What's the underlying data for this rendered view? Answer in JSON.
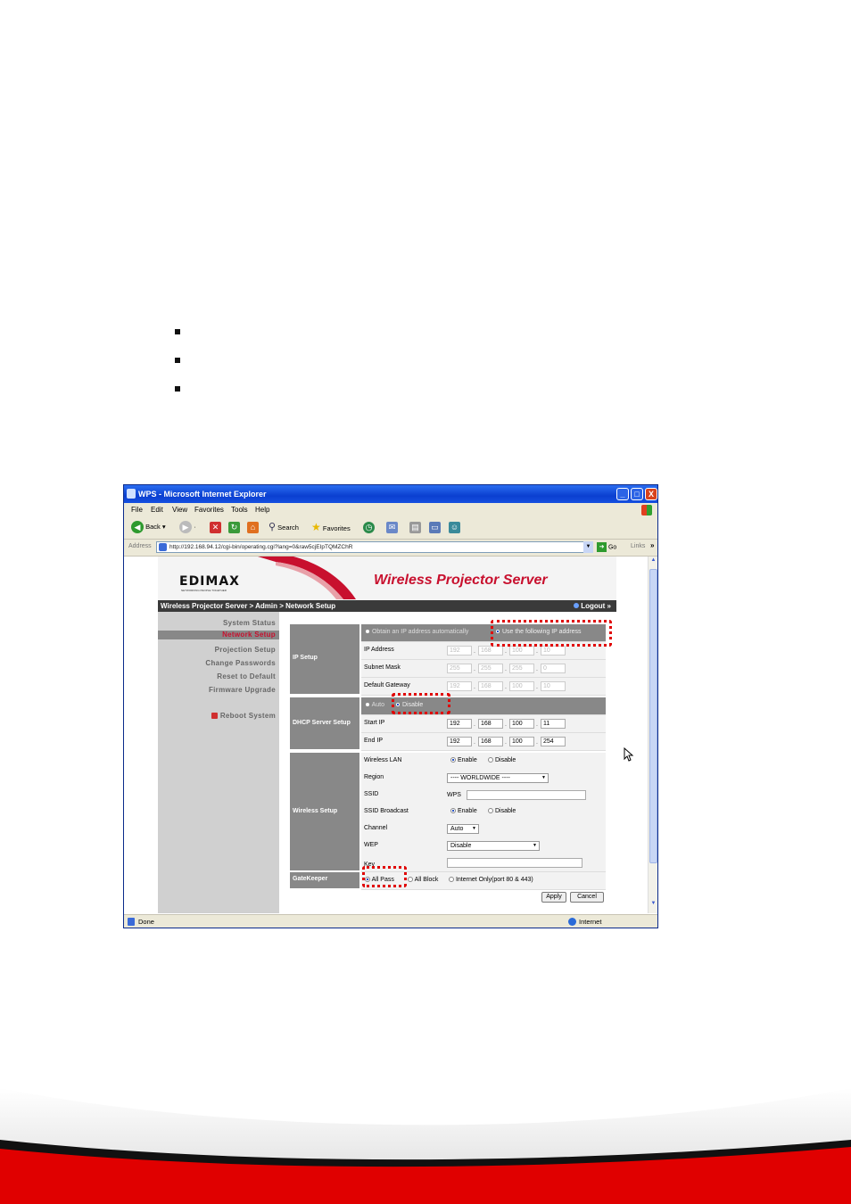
{
  "window": {
    "title": "WPS - Microsoft Internet Explorer",
    "buttons": [
      "_",
      "□",
      "X"
    ]
  },
  "menu": [
    "File",
    "Edit",
    "View",
    "Favorites",
    "Tools",
    "Help"
  ],
  "toolbar": {
    "back": "Back",
    "search": "Search",
    "favorites": "Favorites"
  },
  "address": {
    "label": "Address",
    "url": "http://192.168.94.12/cgi-bin/operating.cgi?lang=0&raw5cjEIpTQMZChR",
    "go": "Go",
    "links": "Links"
  },
  "page": {
    "logo": "EDIMAX",
    "logo_tagline": "NETWORKING PEOPLE TOGETHER",
    "title": "Wireless Projector Server",
    "breadcrumb": "Wireless Projector Server > Admin > Network Setup",
    "logout": "Logout »",
    "nav": [
      "System Status",
      "Network Setup",
      "Projection Setup",
      "Change Passwords",
      "Reset to Default",
      "Firmware Upgrade"
    ],
    "reboot": "Reboot System"
  },
  "ip_setup": {
    "section": "IP Setup",
    "opt_auto": "Obtain an IP address automatically",
    "opt_manual": "Use the following IP address",
    "rows": [
      {
        "label": "IP Address",
        "values": [
          "192",
          "168",
          "100",
          "10"
        ]
      },
      {
        "label": "Subnet Mask",
        "values": [
          "255",
          "255",
          "255",
          "0"
        ]
      },
      {
        "label": "Default Gateway",
        "values": [
          "192",
          "168",
          "100",
          "10"
        ]
      }
    ]
  },
  "dhcp": {
    "section": "DHCP Server Setup",
    "opt_auto": "Auto",
    "opt_disable": "Disable",
    "rows": [
      {
        "label": "Start IP",
        "values": [
          "192",
          "168",
          "100",
          "11"
        ]
      },
      {
        "label": "End IP",
        "values": [
          "192",
          "168",
          "100",
          "254"
        ]
      }
    ]
  },
  "wireless": {
    "section": "Wireless Setup",
    "lan_label": "Wireless LAN",
    "enable": "Enable",
    "disable": "Disable",
    "region_label": "Region",
    "region_value": "---- WORLDWIDE ----",
    "ssid_label": "SSID",
    "ssid_value": "WPS",
    "broadcast_label": "SSID Broadcast",
    "channel_label": "Channel",
    "channel_value": "Auto",
    "wep_label": "WEP",
    "wep_value": "Disable",
    "key_label": "Key"
  },
  "gatekeeper": {
    "section": "GateKeeper",
    "opt_all_pass": "All Pass",
    "opt_all_block": "All Block",
    "opt_internet": "Internet Only(port 80 & 443)"
  },
  "buttons": {
    "apply": "Apply",
    "cancel": "Cancel"
  },
  "status": {
    "left": "Done",
    "zone": "Internet"
  },
  "colors": {
    "brand_red": "#c8102e",
    "highlight": "#e00000",
    "xp_blue": "#0a3fd0"
  }
}
